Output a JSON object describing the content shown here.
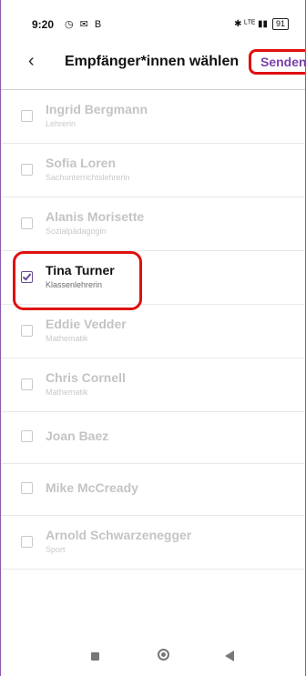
{
  "status_bar": {
    "time": "9:20",
    "left_icons": "◷ ✉ B",
    "right_icons": "✱ ᴸᵀᴱ ▮▮",
    "battery": "91"
  },
  "app_bar": {
    "back_icon": "chevron-left",
    "title": "Empfänger*innen wählen",
    "send_label": "Senden"
  },
  "recipients": [
    {
      "name": "Ingrid Bergmann",
      "role": "Lehrerin",
      "checked": false
    },
    {
      "name": "Sofia Loren",
      "role": "Sachunterrichtslehrerin",
      "checked": false
    },
    {
      "name": "Alanis Morisette",
      "role": "Sozialpädagogin",
      "checked": false
    },
    {
      "name": "Tina Turner",
      "role": "Klassenlehrerin",
      "checked": true
    },
    {
      "name": "Eddie Vedder",
      "role": "Mathematik",
      "checked": false
    },
    {
      "name": "Chris Cornell",
      "role": "Mathematik",
      "checked": false
    },
    {
      "name": "Joan Baez",
      "role": "",
      "checked": false
    },
    {
      "name": "Mike McCready",
      "role": "",
      "checked": false
    },
    {
      "name": "Arnold Schwarzenegger",
      "role": "Sport",
      "checked": false
    }
  ],
  "colors": {
    "accent": "#7a3fa8",
    "highlight": "#e01010",
    "check": "#6a4b96"
  }
}
